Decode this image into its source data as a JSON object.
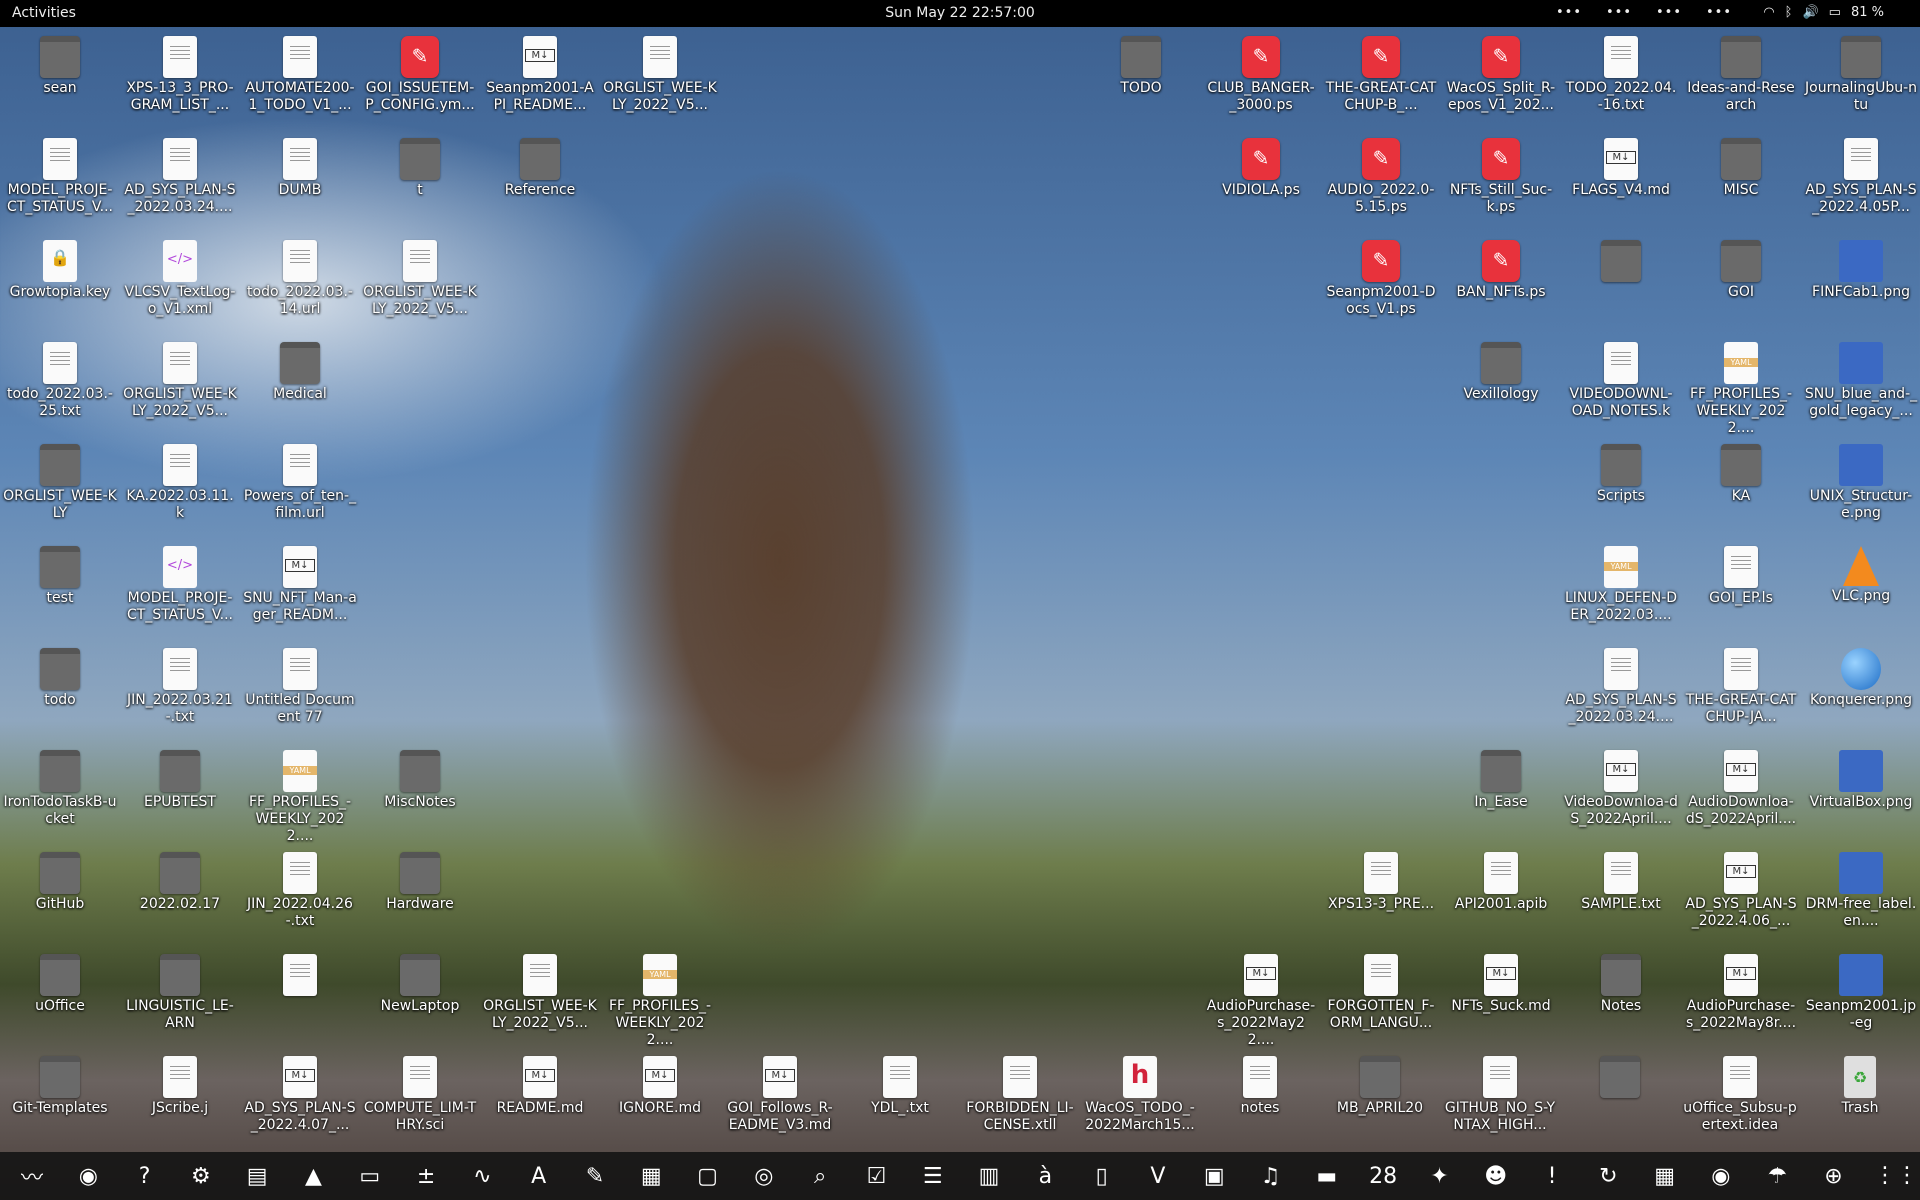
{
  "topbar": {
    "activities": "Activities",
    "clock": "Sun May 22  22:57:00",
    "indicators": [
      "•••",
      "•••",
      "•••",
      "•••"
    ],
    "wifi": "wifi-icon",
    "bluetooth": "bluetooth-icon",
    "volume": "volume-icon",
    "battery": "81 %"
  },
  "desktop": {
    "icons": [
      {
        "label": "sean",
        "type": "folder"
      },
      {
        "label": "XPS-13_3_PRO-GRAM_LIST_...",
        "type": "doc"
      },
      {
        "label": "AUTOMATE200-1_TODO_V1_...",
        "type": "doc"
      },
      {
        "label": "GOI_ISSUETEM-P_CONFIG.ym...",
        "type": "ps"
      },
      {
        "label": "Seanpm2001-API_README...",
        "type": "md"
      },
      {
        "label": "ORGLIST_WEE-KLY_2022_V5...",
        "type": "doc"
      },
      {
        "label": "MODEL_PROJE-CT_STATUS_V...",
        "type": "doc"
      },
      {
        "label": "AD_SYS_PLAN-S_2022.03.24....",
        "type": "doc"
      },
      {
        "label": "DUMB",
        "type": "doc"
      },
      {
        "label": "t",
        "type": "folder"
      },
      {
        "label": "Reference",
        "type": "folder"
      },
      {
        "label": "Growtopia.key",
        "type": "key"
      },
      {
        "label": "VLCSV_TextLog-o_V1.xml",
        "type": "xml"
      },
      {
        "label": "todo_2022.03.-14.url",
        "type": "doc"
      },
      {
        "label": "ORGLIST_WEE-KLY_2022_V5...",
        "type": "doc"
      },
      {
        "label": "todo_2022.03.-25.txt",
        "type": "doc"
      },
      {
        "label": "ORGLIST_WEE-KLY_2022_V5...",
        "type": "doc"
      },
      {
        "label": "Medical",
        "type": "folder"
      },
      {
        "label": "ORGLIST_WEE-KLY",
        "type": "folder"
      },
      {
        "label": "KA.2022.03.11.k",
        "type": "doc"
      },
      {
        "label": "Powers_of_ten-_film.url",
        "type": "doc"
      },
      {
        "label": "test",
        "type": "folder"
      },
      {
        "label": "MODEL_PROJE-CT_STATUS_V...",
        "type": "xml"
      },
      {
        "label": "SNU_NFT_Man-ager_READM...",
        "type": "md"
      },
      {
        "label": "todo",
        "type": "folder"
      },
      {
        "label": "JIN_2022.03.21-.txt",
        "type": "doc"
      },
      {
        "label": "Untitled Document 77",
        "type": "doc"
      },
      {
        "label": "IronTodoTaskB-ucket",
        "type": "folder"
      },
      {
        "label": "EPUBTEST",
        "type": "folder"
      },
      {
        "label": "FF_PROFILES_-WEEKLY_2022....",
        "type": "yaml"
      },
      {
        "label": "MiscNotes",
        "type": "folder"
      },
      {
        "label": "GitHub",
        "type": "folder"
      },
      {
        "label": "2022.02.17",
        "type": "folder"
      },
      {
        "label": "JIN_2022.04.26-.txt",
        "type": "doc"
      },
      {
        "label": "Hardware",
        "type": "folder"
      },
      {
        "label": "uOffice",
        "type": "folder"
      },
      {
        "label": "LINGUISTIC_LE-ARN",
        "type": "folder"
      },
      {
        "label": "",
        "type": "doc"
      },
      {
        "label": "NewLaptop",
        "type": "folder"
      },
      {
        "label": "ORGLIST_WEE-KLY_2022_V5...",
        "type": "doc"
      },
      {
        "label": "FF_PROFILES_-WEEKLY_2022....",
        "type": "yaml"
      },
      {
        "label": "Git-Templates",
        "type": "folder"
      },
      {
        "label": "JScribe.j",
        "type": "doc"
      },
      {
        "label": "AD_SYS_PLAN-S_2022.4.07_...",
        "type": "md"
      },
      {
        "label": "COMPUTE_LIM-THRY.sci",
        "type": "doc"
      },
      {
        "label": "README.md",
        "type": "md"
      },
      {
        "label": "IGNORE.md",
        "type": "md"
      },
      {
        "label": "GOI_Follows_R-EADME_V3.md",
        "type": "md"
      },
      {
        "label": "YDL_.txt",
        "type": "doc"
      },
      {
        "label": "FORBIDDEN_LI-CENSE.xtll",
        "type": "doc"
      },
      {
        "label": "WacOS_TODO_-2022March15...",
        "type": "h"
      },
      {
        "label": "notes",
        "type": "doc"
      },
      {
        "label": "MB_APRIL20",
        "type": "folder"
      },
      {
        "label": "GITHUB_NO_S-YNTAX_HIGH...",
        "type": "doc"
      },
      {
        "label": "",
        "type": "folder"
      },
      {
        "label": "uOffice_Subsu-pertext.idea",
        "type": "doc"
      },
      {
        "label": "Trash",
        "type": "trash"
      },
      {
        "label": "TODO",
        "type": "folder"
      },
      {
        "label": "CLUB_BANGER-_3000.ps",
        "type": "ps"
      },
      {
        "label": "THE-GREAT-CATCHUP-B_...",
        "type": "ps"
      },
      {
        "label": "WacOS_Split_R-epos_V1_202...",
        "type": "ps"
      },
      {
        "label": "TODO_2022.04.-16.txt",
        "type": "doc"
      },
      {
        "label": "Ideas-and-Research",
        "type": "folder"
      },
      {
        "label": "JournalingUbu-ntu",
        "type": "folder"
      },
      {
        "label": "VIDIOLA.ps",
        "type": "ps"
      },
      {
        "label": "AUDIO_2022.0-5.15.ps",
        "type": "ps"
      },
      {
        "label": "NFTs_Still_Suc-k.ps",
        "type": "ps"
      },
      {
        "label": "FLAGS_V4.md",
        "type": "md"
      },
      {
        "label": "MISC",
        "type": "folder"
      },
      {
        "label": "AD_SYS_PLAN-S_2022.4.05P...",
        "type": "doc"
      },
      {
        "label": "Seanpm2001-Docs_V1.ps",
        "type": "ps"
      },
      {
        "label": "BAN_NFTs.ps",
        "type": "ps"
      },
      {
        "label": "",
        "type": "folder"
      },
      {
        "label": "GOI",
        "type": "folder"
      },
      {
        "label": "FINFCab1.png",
        "type": "img"
      },
      {
        "label": "Vexillology",
        "type": "folder"
      },
      {
        "label": "VIDEODOWNL-OAD_NOTES.k",
        "type": "doc"
      },
      {
        "label": "FF_PROFILES_-WEEKLY_2022....",
        "type": "yaml"
      },
      {
        "label": "SNU_blue_and-_gold_legacy_...",
        "type": "img"
      },
      {
        "label": "Scripts",
        "type": "folder"
      },
      {
        "label": "KA",
        "type": "folder"
      },
      {
        "label": "UNIX_Structur-e.png",
        "type": "img"
      },
      {
        "label": "LINUX_DEFEN-DER_2022.03....",
        "type": "yaml"
      },
      {
        "label": "GOI_EP.ls",
        "type": "doc"
      },
      {
        "label": "VLC.png",
        "type": "cone"
      },
      {
        "label": "AD_SYS_PLAN-S_2022.03.24....",
        "type": "doc"
      },
      {
        "label": "THE-GREAT-CATCHUP-JA...",
        "type": "doc"
      },
      {
        "label": "Konquerer.png",
        "type": "globe"
      },
      {
        "label": "In_Ease",
        "type": "folder"
      },
      {
        "label": "VideoDownloa-dS_2022April....",
        "type": "md"
      },
      {
        "label": "AudioDownloa-dS_2022April....",
        "type": "md"
      },
      {
        "label": "VirtualBox.png",
        "type": "img"
      },
      {
        "label": "XPS13-3_PRE...",
        "type": "doc"
      },
      {
        "label": "API2001.apib",
        "type": "doc"
      },
      {
        "label": "SAMPLE.txt",
        "type": "doc"
      },
      {
        "label": "AD_SYS_PLAN-S_2022.4.06_...",
        "type": "md"
      },
      {
        "label": "DRM-free_label.en....",
        "type": "img"
      },
      {
        "label": "AudioPurchase-s_2022May22....",
        "type": "md"
      },
      {
        "label": "FORGOTTEN_F-ORM_LANGU...",
        "type": "doc"
      },
      {
        "label": "NFTs_Suck.md",
        "type": "md"
      },
      {
        "label": "Notes",
        "type": "folder"
      },
      {
        "label": "AudioPurchase-s_2022May8r....",
        "type": "md"
      },
      {
        "label": "Seanpm2001.jp-eg",
        "type": "img"
      }
    ]
  },
  "dock": {
    "apps": [
      {
        "name": "system-monitor-icon",
        "glyph": "〰"
      },
      {
        "name": "firefox-icon",
        "glyph": "◉"
      },
      {
        "name": "help-icon",
        "glyph": "?"
      },
      {
        "name": "settings-icon",
        "glyph": "⚙"
      },
      {
        "name": "document-viewer-icon",
        "glyph": "▤"
      },
      {
        "name": "vlc-icon",
        "glyph": "▲"
      },
      {
        "name": "terminal-icon",
        "glyph": "▭"
      },
      {
        "name": "calculator-icon",
        "glyph": "±"
      },
      {
        "name": "audio-editor-icon",
        "glyph": "∿"
      },
      {
        "name": "software-center-icon",
        "glyph": "A"
      },
      {
        "name": "text-editor-icon",
        "glyph": "✎"
      },
      {
        "name": "calc-icon",
        "glyph": "▦"
      },
      {
        "name": "files-icon",
        "glyph": "▢"
      },
      {
        "name": "disks-icon",
        "glyph": "◎"
      },
      {
        "name": "image-viewer-icon",
        "glyph": "⌕"
      },
      {
        "name": "tasks-icon",
        "glyph": "☑"
      },
      {
        "name": "ebook-reader-icon",
        "glyph": "☰"
      },
      {
        "name": "scanner-icon",
        "glyph": "▥"
      },
      {
        "name": "character-map-icon",
        "glyph": "à"
      },
      {
        "name": "archive-manager-icon",
        "glyph": "▯"
      },
      {
        "name": "vim-icon",
        "glyph": "V"
      },
      {
        "name": "screenshot-icon",
        "glyph": "▣"
      },
      {
        "name": "music-icon",
        "glyph": "♫"
      },
      {
        "name": "pdf-viewer-icon",
        "glyph": "▬"
      },
      {
        "name": "calendar-icon",
        "glyph": "28"
      },
      {
        "name": "gimp-icon",
        "glyph": "✦"
      },
      {
        "name": "game-icon",
        "glyph": "☻"
      },
      {
        "name": "error-reporter-icon",
        "glyph": "!"
      },
      {
        "name": "updater-icon",
        "glyph": "↻"
      },
      {
        "name": "spreadsheet-icon",
        "glyph": "▦"
      },
      {
        "name": "webcam-icon",
        "glyph": "◉"
      },
      {
        "name": "weather-icon",
        "glyph": "☂"
      },
      {
        "name": "app-center-icon",
        "glyph": "⊕"
      }
    ],
    "show_apps": "⋮⋮⋮"
  }
}
